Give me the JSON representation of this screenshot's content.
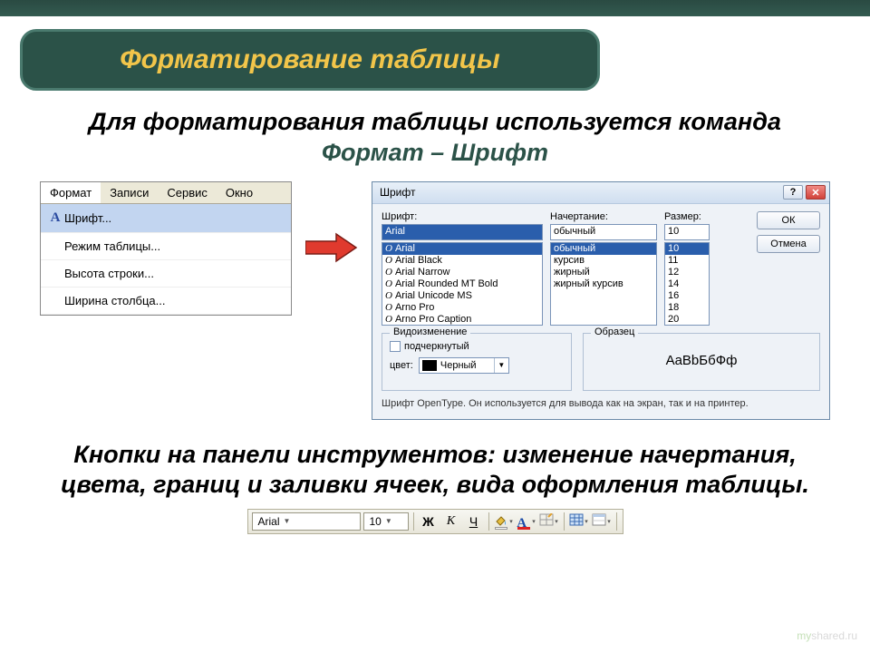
{
  "slide": {
    "title": "Форматирование таблицы",
    "intro_plain": "Для форматирования таблицы используется команда ",
    "intro_cmd": "Формат – Шрифт",
    "bottom": "Кнопки на панели инструментов: изменение начертания, цвета, границ и заливки ячеек, вида оформления таблицы."
  },
  "menu": {
    "bar": [
      "Формат",
      "Записи",
      "Сервис",
      "Окно"
    ],
    "items": [
      {
        "icon": "A",
        "label": "Шрифт...",
        "hi": true
      },
      {
        "icon": "",
        "label": "Режим таблицы..."
      },
      {
        "icon": "",
        "label": "Высота строки..."
      },
      {
        "icon": "",
        "label": "Ширина столбца..."
      }
    ]
  },
  "dialog": {
    "title": "Шрифт",
    "labels": {
      "font": "Шрифт:",
      "style": "Начертание:",
      "size": "Размер:"
    },
    "font_input": "Arial",
    "fonts": [
      "Arial",
      "Arial Black",
      "Arial Narrow",
      "Arial Rounded MT Bold",
      "Arial Unicode MS",
      "Arno Pro",
      "Arno Pro Caption"
    ],
    "font_selected": "Arial",
    "style_input": "обычный",
    "styles": [
      "обычный",
      "курсив",
      "жирный",
      "жирный курсив"
    ],
    "style_selected": "обычный",
    "size_input": "10",
    "sizes": [
      "10",
      "11",
      "12",
      "14",
      "16",
      "18",
      "20"
    ],
    "size_selected": "10",
    "buttons": {
      "ok": "ОК",
      "cancel": "Отмена"
    },
    "group_effects": "Видоизменение",
    "chk_underline": "подчеркнутый",
    "color_label": "цвет:",
    "color_value": "Черный",
    "group_sample": "Образец",
    "sample_text": "AaBbБбФф",
    "hint": "Шрифт OpenType. Он используется для вывода как на экран, так и на принтер."
  },
  "toolbar": {
    "font": "Arial",
    "size": "10",
    "bold": "Ж",
    "italic": "К",
    "underline": "Ч"
  },
  "watermark": {
    "prefix": "my",
    "suffix": "shared.ru"
  }
}
